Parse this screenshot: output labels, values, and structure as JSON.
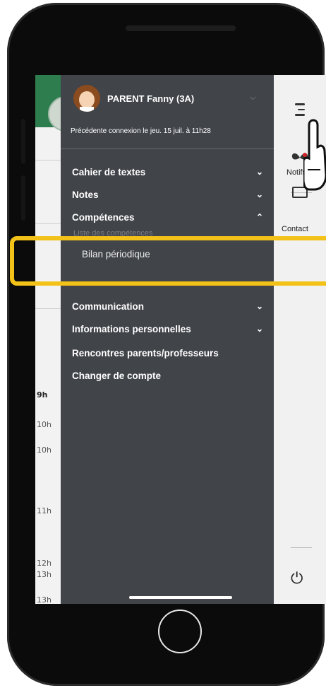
{
  "profile": {
    "name": "PARENT Fanny (3A)",
    "last_login": "Précédente connexion le jeu. 15 juil. à 11h28"
  },
  "menu": {
    "items": [
      {
        "label": "Cahier de textes",
        "chevron": "chevron-down-icon"
      },
      {
        "label": "Notes",
        "chevron": "chevron-down-icon"
      },
      {
        "label": "Compétences",
        "chevron": "chevron-up-icon"
      },
      {
        "label": "Communication",
        "chevron": "chevron-down-icon"
      },
      {
        "label": "Informations personnelles",
        "chevron": "chevron-down-icon"
      },
      {
        "label": "Rencontres parents/professeurs"
      },
      {
        "label": "Changer de compte"
      }
    ],
    "competences_sub": {
      "partially_hidden": "Liste des compétences",
      "highlighted": "Bilan périodique"
    }
  },
  "right_strip": {
    "notifs_label": "Notifs",
    "contact_label": "Contact"
  },
  "background_times": [
    "9h",
    "10h",
    "10h",
    "11h",
    "12h",
    "13h",
    "13h"
  ],
  "colors": {
    "drawer": "#414449",
    "highlight": "#f3c218",
    "strip": "#f1f1f1"
  }
}
